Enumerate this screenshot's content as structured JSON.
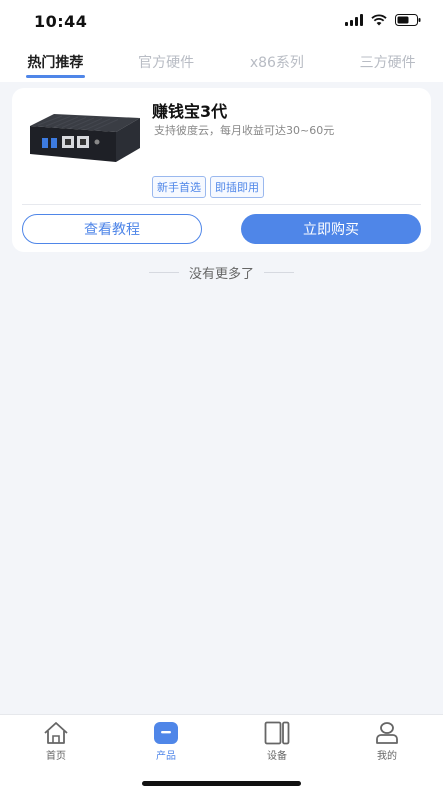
{
  "status_bar": {
    "time": "10:44"
  },
  "tabs": [
    {
      "label": "热门推荐",
      "active": true
    },
    {
      "label": "官方硬件",
      "active": false
    },
    {
      "label": "x86系列",
      "active": false
    },
    {
      "label": "三方硬件",
      "active": false
    }
  ],
  "product": {
    "title": "赚钱宝3代",
    "description": "支持彼度云，每月收益可达30~60元",
    "tags": [
      "新手首选",
      "即插即用"
    ],
    "tutorial_label": "查看教程",
    "buy_label": "立即购买"
  },
  "list_footer": "没有更多了",
  "bottom_nav": [
    {
      "label": "首页",
      "icon": "home-icon",
      "active": false
    },
    {
      "label": "产品",
      "icon": "product-icon",
      "active": true
    },
    {
      "label": "设备",
      "icon": "device-icon",
      "active": false
    },
    {
      "label": "我的",
      "icon": "profile-icon",
      "active": false
    }
  ],
  "colors": {
    "accent": "#4f86e8",
    "background": "#f3f5f9"
  }
}
